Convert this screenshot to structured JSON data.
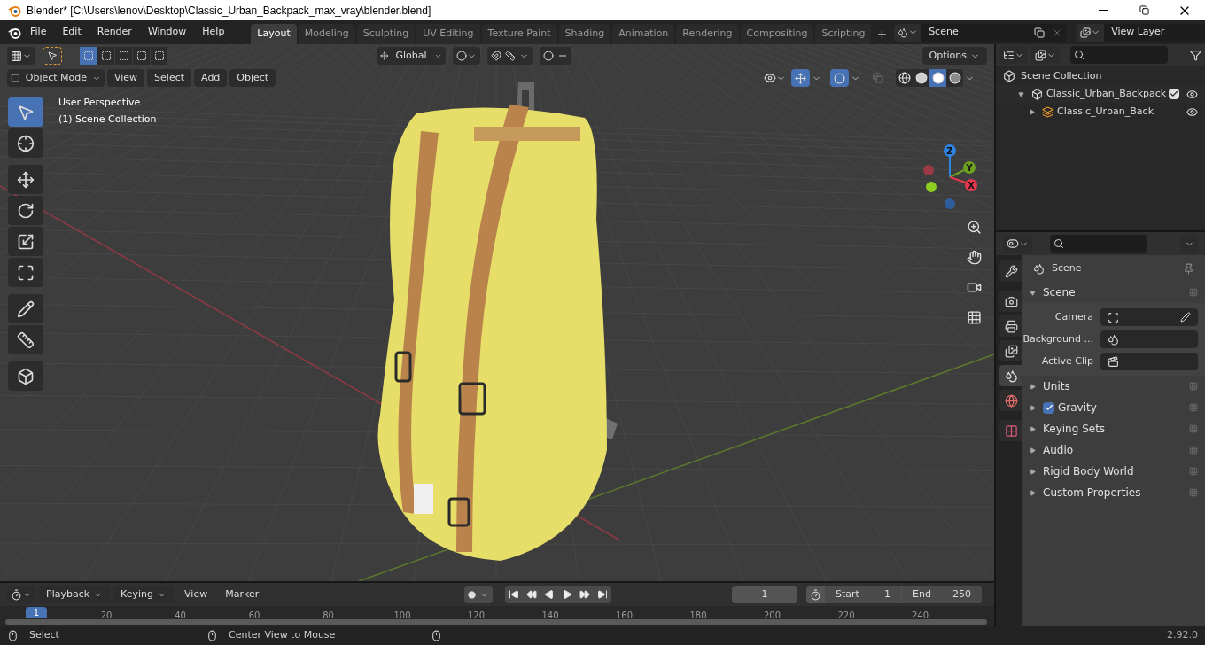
{
  "title_bar": {
    "title": "Blender* [C:\\Users\\lenov\\Desktop\\Classic_Urban_Backpack_max_vray\\blender.blend]"
  },
  "menu": [
    "File",
    "Edit",
    "Render",
    "Window",
    "Help"
  ],
  "workspaces": [
    {
      "label": "Layout",
      "selected": true
    },
    {
      "label": "Modeling",
      "selected": false
    },
    {
      "label": "Sculpting",
      "selected": false
    },
    {
      "label": "UV Editing",
      "selected": false
    },
    {
      "label": "Texture Paint",
      "selected": false
    },
    {
      "label": "Shading",
      "selected": false
    },
    {
      "label": "Animation",
      "selected": false
    },
    {
      "label": "Rendering",
      "selected": false
    },
    {
      "label": "Compositing",
      "selected": false
    },
    {
      "label": "Scripting",
      "selected": false
    }
  ],
  "add_workspace": "+",
  "scene": {
    "value": "Scene"
  },
  "view_layer": {
    "value": "View Layer"
  },
  "viewport": {
    "orientation": "Global",
    "options": "Options",
    "mode": "Object Mode",
    "menus": [
      "View",
      "Select",
      "Add",
      "Object"
    ],
    "select_modes": [
      {
        "selected": true
      },
      {
        "selected": false
      },
      {
        "selected": false
      },
      {
        "selected": false
      },
      {
        "selected": false
      }
    ],
    "shading": [
      {
        "kind": "wireframe",
        "selected": false
      },
      {
        "kind": "solid",
        "selected": false
      },
      {
        "kind": "material",
        "selected": true
      },
      {
        "kind": "rendered",
        "selected": false
      }
    ],
    "overlay_lines": [
      "User Perspective",
      "(1) Scene Collection"
    ],
    "tools": [
      {
        "kind": "select",
        "selected": true
      },
      {
        "kind": "cursor",
        "selected": false
      },
      {
        "kind": "move",
        "selected": false
      },
      {
        "kind": "rotate",
        "selected": false
      },
      {
        "kind": "scale",
        "selected": false
      },
      {
        "kind": "transform",
        "selected": false
      },
      {
        "kind": "annotate",
        "selected": false
      },
      {
        "kind": "measure",
        "selected": false
      },
      {
        "kind": "add_cube",
        "selected": false
      }
    ],
    "gizmo_axes": [
      "Z",
      "Y",
      "X"
    ]
  },
  "outliner": {
    "rows": [
      {
        "label": "Scene Collection",
        "children": [
          {
            "label": "Classic_Urban_Backpack",
            "expanded": true,
            "checked": true,
            "children": [
              {
                "label": "Classic_Urban_Back",
                "expanded": false
              }
            ]
          }
        ]
      }
    ]
  },
  "properties": {
    "tabs": [
      {
        "kind": "tool",
        "selected": false
      },
      {
        "kind": "render",
        "selected": false
      },
      {
        "kind": "output",
        "selected": false
      },
      {
        "kind": "view_layer",
        "selected": false
      },
      {
        "kind": "scene",
        "selected": true
      },
      {
        "kind": "world",
        "selected": false
      },
      {
        "kind": "texture",
        "selected": false
      }
    ],
    "context": "Scene",
    "panels": [
      {
        "label": "Scene",
        "expanded": true,
        "fields": [
          {
            "label": "Camera",
            "kind": "camera"
          },
          {
            "label": "Background ...",
            "kind": "scene"
          },
          {
            "label": "Active Clip",
            "kind": "clip"
          }
        ]
      },
      {
        "label": "Units",
        "expanded": false
      },
      {
        "label": "Gravity",
        "expanded": false,
        "kind": "checkbox",
        "checked": true
      },
      {
        "label": "Keying Sets",
        "expanded": false
      },
      {
        "label": "Audio",
        "expanded": false
      },
      {
        "label": "Rigid Body World",
        "expanded": false
      },
      {
        "label": "Custom Properties",
        "expanded": false
      }
    ]
  },
  "timeline": {
    "menus": [
      {
        "label": "Playback",
        "kind": "dropdown"
      },
      {
        "label": "Keying",
        "kind": "dropdown"
      },
      {
        "label": "View",
        "kind": "menu"
      },
      {
        "label": "Marker",
        "kind": "menu"
      }
    ],
    "current_frame": "1",
    "start_label": "Start",
    "start": "1",
    "end_label": "End",
    "end": "250",
    "ruler_current": "1",
    "ruler": [
      "20",
      "40",
      "60",
      "80",
      "100",
      "120",
      "140",
      "160",
      "180",
      "200",
      "220",
      "240"
    ]
  },
  "status_bar": {
    "hints": [
      "Select",
      "Center View to Mouse"
    ],
    "version": "2.92.0"
  }
}
